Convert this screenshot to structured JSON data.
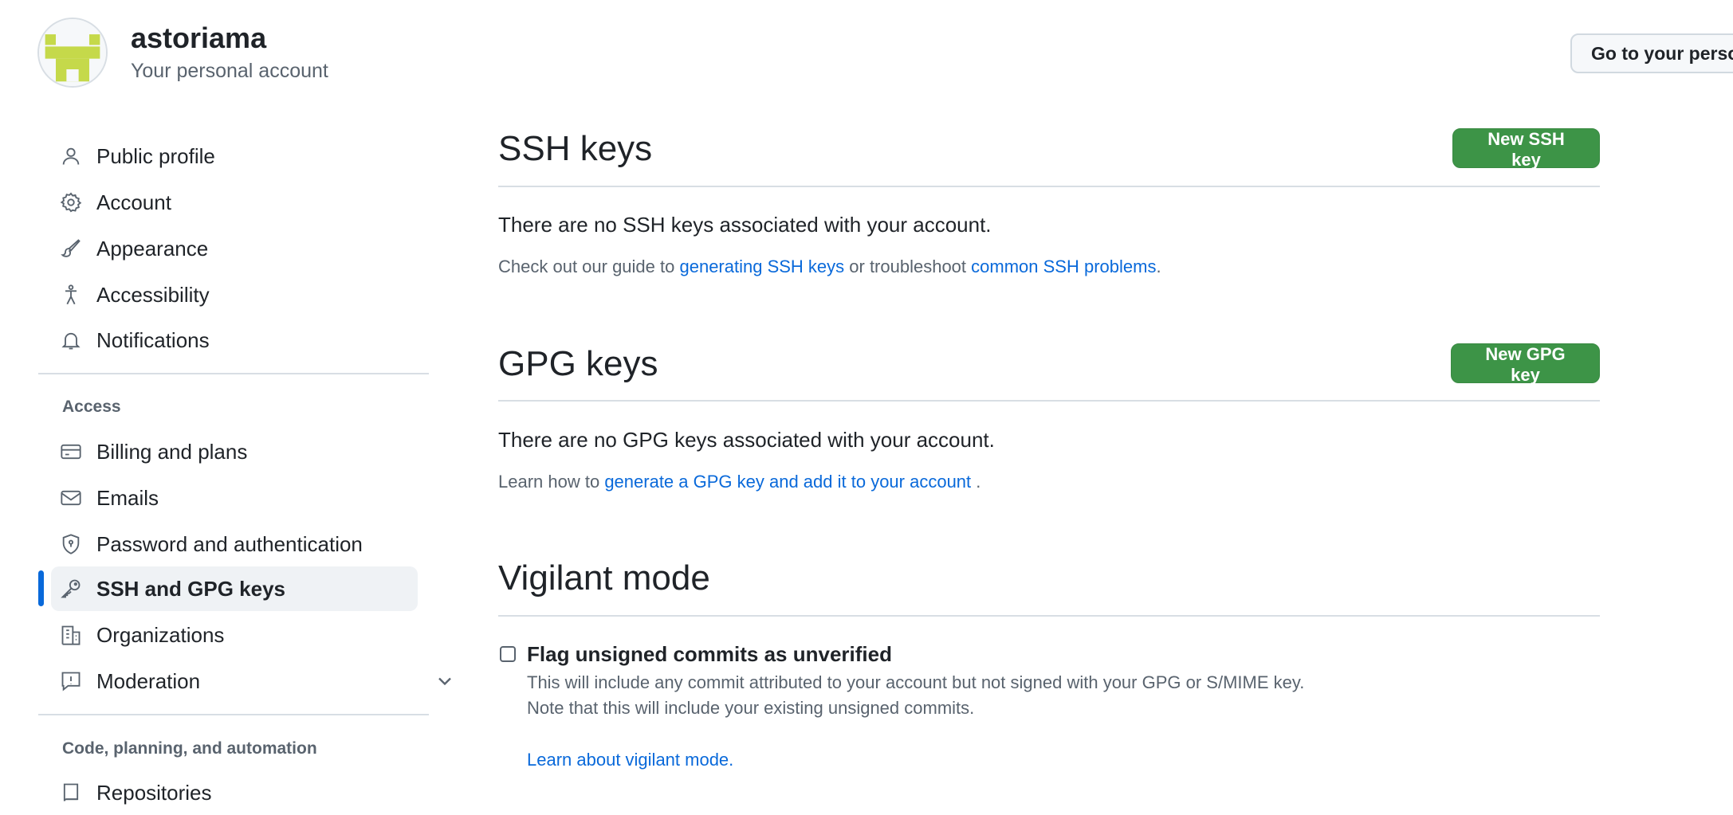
{
  "header": {
    "account_name": "astoriama",
    "account_sub": "Your personal account",
    "go_profile_label": "Go to your personal profile"
  },
  "sidebar": {
    "items": [
      {
        "label": "Public profile",
        "icon": "person-icon"
      },
      {
        "label": "Account",
        "icon": "gear-icon"
      },
      {
        "label": "Appearance",
        "icon": "paintbrush-icon"
      },
      {
        "label": "Accessibility",
        "icon": "accessibility-icon"
      },
      {
        "label": "Notifications",
        "icon": "bell-icon"
      }
    ],
    "access_heading": "Access",
    "access_items": [
      {
        "label": "Billing and plans",
        "icon": "credit-card-icon"
      },
      {
        "label": "Emails",
        "icon": "mail-icon"
      },
      {
        "label": "Password and authentication",
        "icon": "shield-lock-icon"
      },
      {
        "label": "SSH and GPG keys",
        "icon": "key-icon",
        "active": true
      },
      {
        "label": "Organizations",
        "icon": "organization-icon"
      },
      {
        "label": "Moderation",
        "icon": "report-icon",
        "expandable": true
      }
    ],
    "code_heading": "Code, planning, and automation",
    "code_items": [
      {
        "label": "Repositories",
        "icon": "repo-icon"
      }
    ]
  },
  "ssh": {
    "title": "SSH keys",
    "button": "New SSH key",
    "empty": "There are no SSH keys associated with your account.",
    "guide_prefix": "Check out our guide to ",
    "guide_link": "generating SSH keys",
    "guide_mid": " or troubleshoot ",
    "problems_link": "common SSH problems",
    "guide_suffix": "."
  },
  "gpg": {
    "title": "GPG keys",
    "button": "New GPG key",
    "empty": "There are no GPG keys associated with your account.",
    "learn_prefix": "Learn how to ",
    "learn_link": "generate a GPG key and add it to your account",
    "learn_suffix": " ."
  },
  "vigilant": {
    "title": "Vigilant mode",
    "checkbox_label": "Flag unsigned commits as unverified",
    "checked": false,
    "desc1": "This will include any commit attributed to your account but not signed with your GPG or S/MIME key.",
    "desc2": "Note that this will include your existing unsigned commits.",
    "learn_link": "Learn about vigilant mode."
  },
  "colors": {
    "accent": "#0969da",
    "primary_button": "#3d9447",
    "avatar_identicon": "#c5d94a"
  }
}
